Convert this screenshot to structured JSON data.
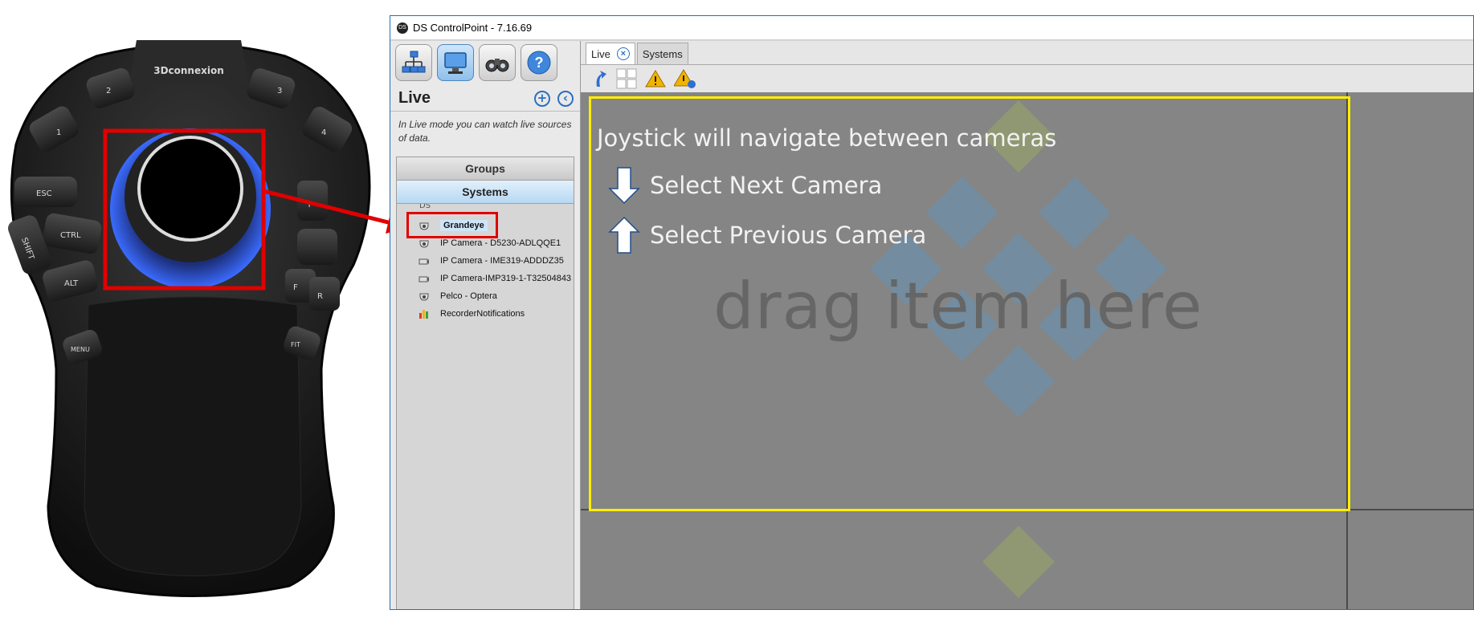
{
  "device": {
    "brand": "3Dconnexion",
    "keys": {
      "k1": "1",
      "k2": "2",
      "k3": "3",
      "k4": "4",
      "esc": "ESC",
      "ctrl": "CTRL",
      "shift": "SHIFT",
      "alt": "ALT",
      "menu": "MENU",
      "fit": "FIT",
      "t": "T",
      "f": "F",
      "r": "R"
    }
  },
  "window": {
    "title": "DS ControlPoint - 7.16.69"
  },
  "sidebar": {
    "toolbar": [
      {
        "name": "network-icon"
      },
      {
        "name": "monitor-icon"
      },
      {
        "name": "binoculars-icon"
      },
      {
        "name": "help-icon",
        "glyph": "?"
      }
    ],
    "live_title": "Live",
    "add_glyph": "+",
    "collapse_glyph": "‹",
    "description": "In Live mode you can watch live sources of data.",
    "groups_label": "Groups",
    "systems_label": "Systems",
    "tree_root": "DS",
    "items": [
      {
        "label": "Grandeye",
        "icon": "dome-camera-icon",
        "selected": true
      },
      {
        "label": "IP Camera - D5230-ADLQQE1",
        "icon": "dome-camera-icon"
      },
      {
        "label": "IP Camera - IME319-ADDDZ35",
        "icon": "box-camera-icon"
      },
      {
        "label": "IP Camera-IMP319-1-T32504843",
        "icon": "box-camera-icon"
      },
      {
        "label": "Pelco - Optera",
        "icon": "dome-camera-icon"
      },
      {
        "label": "RecorderNotifications",
        "icon": "bar-chart-icon"
      }
    ]
  },
  "tabs": [
    {
      "label": "Live",
      "active": true,
      "close_glyph": "×"
    },
    {
      "label": "Systems"
    }
  ],
  "main": {
    "placeholder": "drag item here"
  },
  "overlay": {
    "heading": "Joystick will navigate between cameras",
    "next_label": "Select Next Camera",
    "prev_label": "Select Previous Camera"
  },
  "colors": {
    "highlight": "#ffee00",
    "callout": "#e00000",
    "accent": "#2a6fc0"
  }
}
